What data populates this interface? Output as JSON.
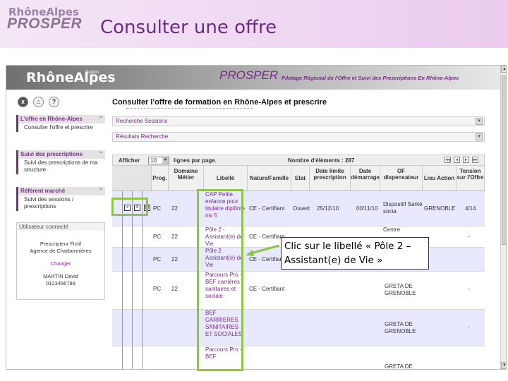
{
  "slide": {
    "logo_line1": "RhôneAlpes",
    "logo_line2": "PROSPER",
    "title": "Consulter une offre"
  },
  "app": {
    "logo": "RhôneAlpes",
    "logo_sup": "Région",
    "name": "PROSPER",
    "subtitle": "Pilotage Régional de l'Offre et Suivi des Prescriptions En Rhône-Alpes"
  },
  "toolbar_buttons": [
    {
      "label": "x",
      "icon": "close-icon"
    },
    {
      "label": "⌂",
      "icon": "home-icon"
    },
    {
      "label": "?",
      "icon": "help-icon"
    }
  ],
  "sidebar": {
    "panels": [
      {
        "title": "L'offre en Rhône-Alpes",
        "items": [
          "Consulter l'offre et prescrire"
        ]
      },
      {
        "title": "Suivi des prescriptions",
        "items": [
          "Suivi des prescriptions de ma structure"
        ]
      },
      {
        "title": "Référent marché",
        "items": [
          "Suivi des sessions / prescriptions"
        ]
      }
    ],
    "user": {
      "header": "Utilisateur connecté",
      "role": "Prescripteur Fictif",
      "agency": "Agence de Charbonnières",
      "change": "Changer",
      "name": "MARTIN David",
      "phone": "0123456789"
    }
  },
  "main": {
    "title": "Consulter l'offre de formation en Rhône-Alpes et prescrire",
    "search_bar": "Recherche Sessions",
    "results_bar": "Résultats Recherche",
    "afficher": "Afficher",
    "page_size": "10",
    "per_page": "lignes par page.",
    "count_label": "Nombre d'éléments : 287",
    "nav": [
      "◂◂",
      "◂",
      "▸",
      "▸▸"
    ]
  },
  "table": {
    "headers": [
      "Prog.",
      "Domaine Métier",
      "Libellé",
      "Nature/Famille",
      "Etat",
      "Date limite prescription",
      "Date démarrage",
      "OF dispensateur",
      "Lieu Action",
      "Tension sur l'Offre"
    ],
    "rows": [
      {
        "prog": "PC",
        "dom": "22",
        "lib": "CAP Petite enfance pour titulaire diplôme niv 5",
        "nature": "CE - Certifiant",
        "etat": "Ouvert",
        "dlim": "25/12/10",
        "ddem": "00/11/10",
        "of": "Dispositif Santé socia",
        "lieu": "GRENOBLE",
        "tension": "4/14"
      },
      {
        "prog": "PC",
        "dom": "22",
        "lib": "Pôle 2 - Assistant(e) de Vie",
        "nature": "CE - Certifiant",
        "etat": "",
        "dlim": "",
        "ddem": "",
        "of": "Centre",
        "lieu": "",
        "tension": "-"
      },
      {
        "prog": "PC",
        "dom": "22",
        "lib": "Pôle 2 Assistant(e) de Vie",
        "nature": "CE - Certifiant",
        "etat": "",
        "dlim": "",
        "ddem": "",
        "of": "",
        "lieu": "",
        "tension": ""
      },
      {
        "prog": "PC",
        "dom": "22",
        "lib": "Parcours Pro - BEF carrières sanitaires et sociale",
        "nature": "CE - Certifiant",
        "etat": "",
        "dlim": "",
        "ddem": "",
        "of": "GRETA DE GRENOBLE",
        "lieu": "",
        "tension": "-"
      },
      {
        "prog": "",
        "dom": "",
        "lib": "BEF CARRIERES SANITAIRES ET SOCIALES",
        "nature": "",
        "etat": "",
        "dlim": "",
        "ddem": "",
        "of": "GRETA DE GRENOBLE",
        "lieu": "",
        "tension": "-"
      },
      {
        "prog": "",
        "dom": "",
        "lib": "Parcours Pro - BEF",
        "nature": "",
        "etat": "",
        "dlim": "",
        "ddem": "",
        "of": "GRETA DE",
        "lieu": "",
        "tension": ""
      }
    ]
  },
  "callout": {
    "line1": "Clic sur le libellé « Pôle 2 –",
    "line2": "Assistant(e) de Vie »"
  },
  "colors": {
    "brand_purple": "#7a2a8a",
    "highlight_green": "#8dc63f",
    "row_alt": "#e8e8ff"
  }
}
